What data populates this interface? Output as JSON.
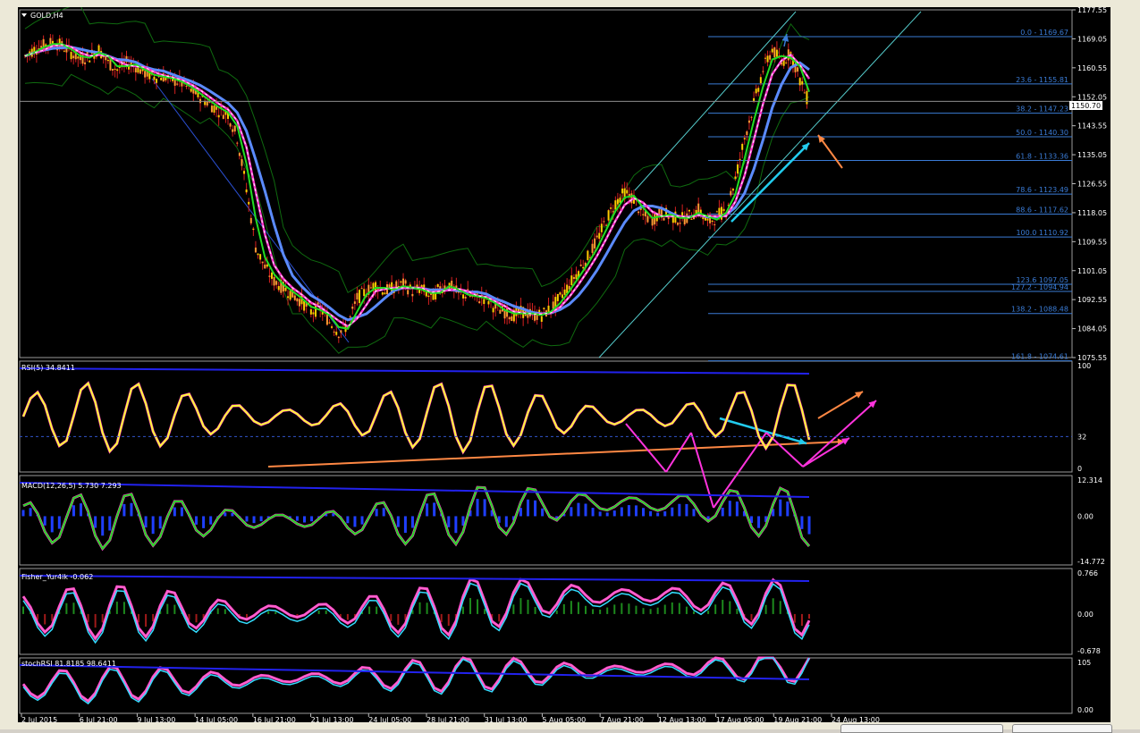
{
  "chart_data": {
    "type": "line",
    "symbol_label": "GOLD,H4",
    "price_axis": {
      "min": 1075.55,
      "max": 1177.55,
      "ticks": [
        "1177.55",
        "1169.05",
        "1160.55",
        "1152.05",
        "1143.55",
        "1135.05",
        "1126.55",
        "1118.05",
        "1109.55",
        "1101.05",
        "1092.55",
        "1084.05",
        "1075.55"
      ],
      "current_price": "1150.70"
    },
    "fibonacci_levels": [
      {
        "label": "0.0 - 1169.67",
        "price": 1169.67
      },
      {
        "label": "23.6 - 1155.81",
        "price": 1155.81
      },
      {
        "label": "38.2 - 1147.23",
        "price": 1147.23
      },
      {
        "label": "50.0 - 1140.30",
        "price": 1140.3
      },
      {
        "label": "61.8 - 1133.36",
        "price": 1133.36
      },
      {
        "label": "78.6 - 1123.49",
        "price": 1123.49
      },
      {
        "label": "88.6 - 1117.62",
        "price": 1117.62
      },
      {
        "label": "100.0 1110.92",
        "price": 1110.92
      },
      {
        "label": "123.6 1097.05",
        "price": 1097.05
      },
      {
        "label": "127.2 - 1094.94",
        "price": 1094.94
      },
      {
        "label": "138.2 - 1088.48",
        "price": 1088.48
      },
      {
        "label": "161.8 - 1074.61",
        "price": 1074.61
      }
    ],
    "x_ticks": [
      "2 Jul 2015",
      "6 Jul 21:00",
      "9 Jul 13:00",
      "14 Jul 05:00",
      "16 Jul 21:00",
      "21 Jul 13:00",
      "24 Jul 05:00",
      "28 Jul 21:00",
      "31 Jul 13:00",
      "5 Aug 05:00",
      "7 Aug 21:00",
      "12 Aug 13:00",
      "17 Aug 05:00",
      "19 Aug 21:00",
      "24 Aug 13:00"
    ],
    "price_series": [
      1164,
      1166,
      1167,
      1168,
      1167,
      1165,
      1163,
      1164,
      1166,
      1162,
      1160,
      1162,
      1161,
      1159,
      1158,
      1158,
      1157,
      1156,
      1154,
      1152,
      1150,
      1148,
      1147,
      1140,
      1125,
      1108,
      1102,
      1098,
      1096,
      1094,
      1092,
      1089,
      1090,
      1086,
      1083,
      1085,
      1093,
      1095,
      1097,
      1095,
      1096,
      1097,
      1095,
      1096,
      1093,
      1096,
      1097,
      1094,
      1094,
      1093,
      1093,
      1090,
      1089,
      1088,
      1089,
      1088,
      1088,
      1090,
      1093,
      1097,
      1101,
      1105,
      1110,
      1116,
      1121,
      1124,
      1122,
      1117,
      1116,
      1118,
      1117,
      1116,
      1117,
      1119,
      1115,
      1117,
      1119,
      1128,
      1140,
      1150,
      1160,
      1166,
      1162,
      1165,
      1157,
      1150
    ],
    "panels": [
      {
        "name": "RSI(5) 34.8411",
        "ticks": [
          "100",
          "32",
          "0"
        ],
        "level": 32,
        "range": [
          0,
          100
        ]
      },
      {
        "name": "MACD(12,26,5) 5.730 7.293",
        "ticks": [
          "12.314",
          "0.00",
          "-14.772"
        ],
        "range": [
          -14.772,
          12.314
        ]
      },
      {
        "name": "Fisher_Yur4ik -0.062",
        "ticks": [
          "0.766",
          "0.00",
          "-0.678"
        ],
        "range": [
          -0.678,
          0.766
        ]
      },
      {
        "name": "stochRSI 81.8185 98.6411",
        "ticks": [
          "105",
          "0.00"
        ],
        "range": [
          0,
          105
        ]
      }
    ],
    "colors": {
      "candle_up": "#ff9933",
      "candle_down": "#ffcc00",
      "ma_fast": "#22dd22",
      "ma_mid": "#ff33cc",
      "ma_slow": "#5b8bff",
      "bollinger": "#0f6a0f",
      "fib": "#3a7bd5",
      "rsi": "#ffff33",
      "macd": "#22dd22",
      "histogram": "#1f3fff",
      "annotation_orange": "#ff8844",
      "annotation_cyan": "#22ccee",
      "annotation_magenta": "#ff33dd",
      "channel": "#55cccc"
    }
  }
}
